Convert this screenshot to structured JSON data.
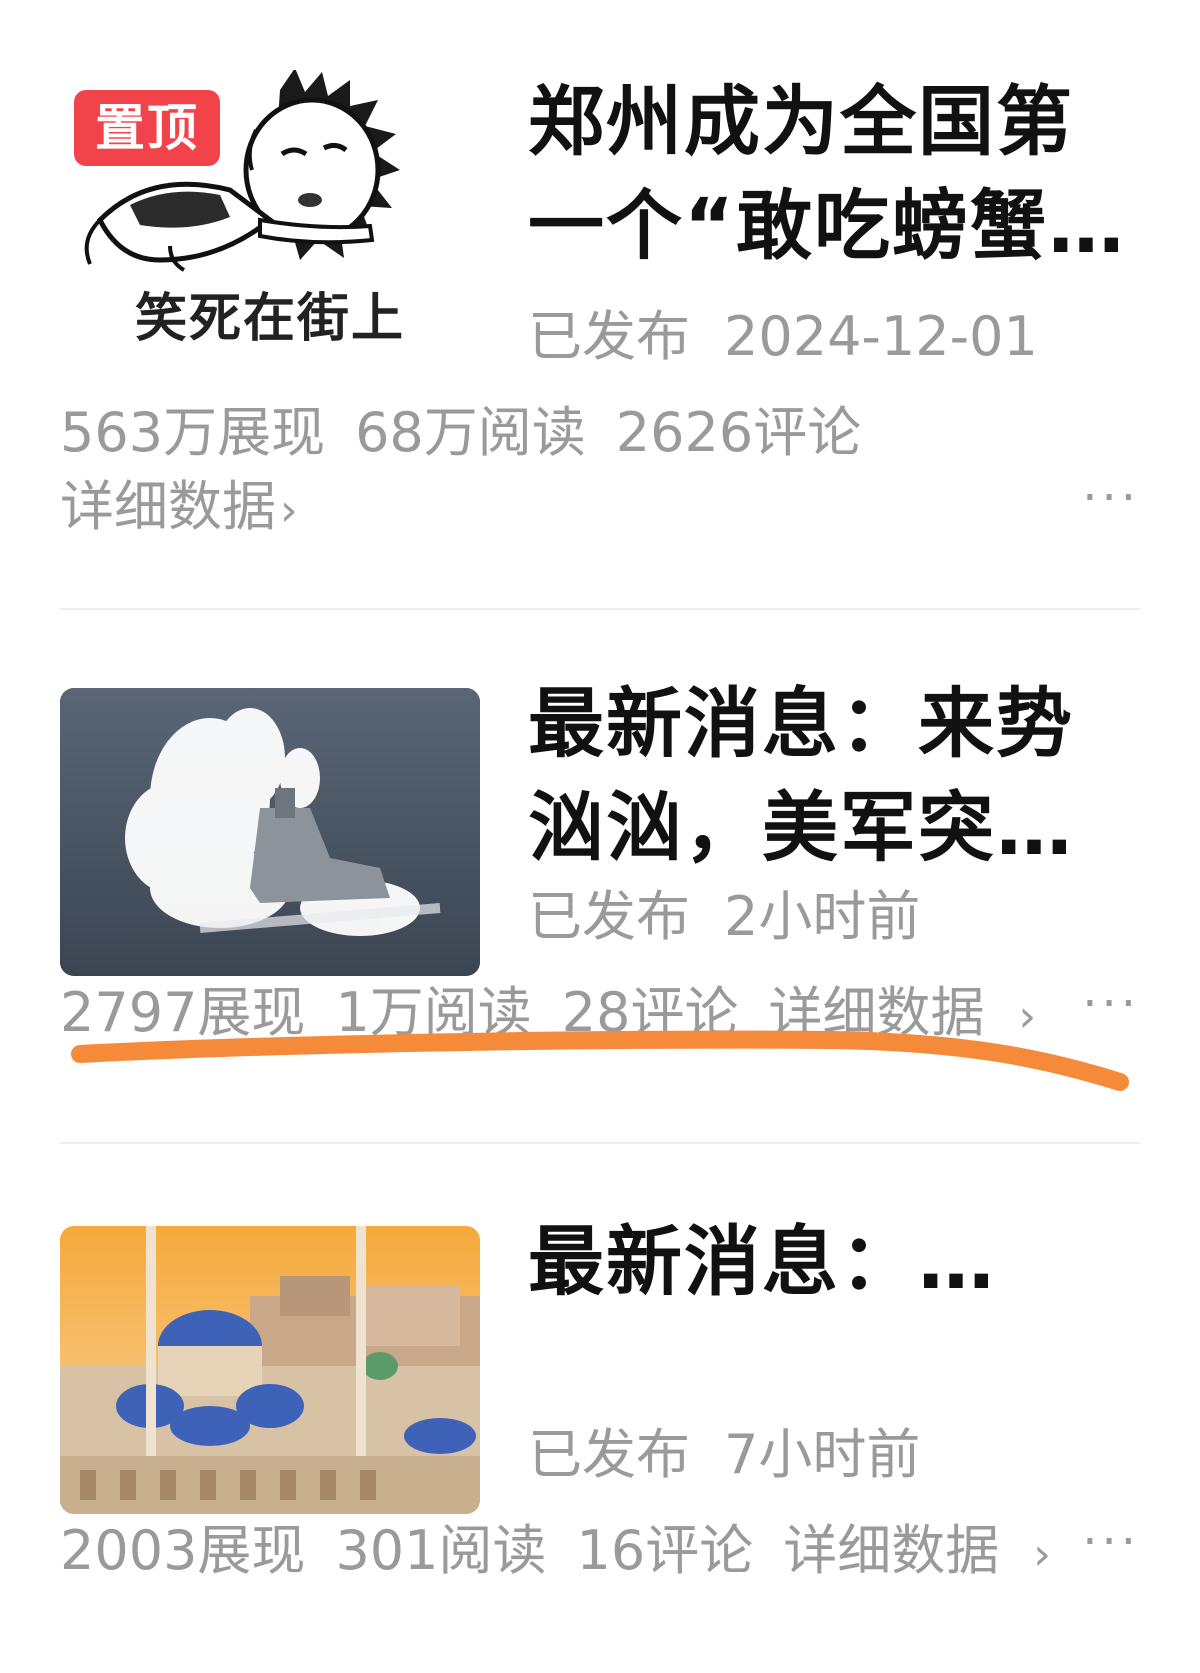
{
  "articles": [
    {
      "pin_label": "置顶",
      "thumb_caption": "笑死在街上",
      "title": "郑州成为全国第一个“敢吃螃蟹…",
      "status": "已发布",
      "time": "2024-12-01",
      "impressions": "563万展现",
      "reads": "68万阅读",
      "comments": "2626评论",
      "detail_label": "详细数据",
      "chevron": "›",
      "more_icon": "ellipsis-icon"
    },
    {
      "title": "最新消息：来势汹汹，美军突…",
      "status": "已发布",
      "time": "2小时前",
      "impressions": "2797展现",
      "reads": "1万阅读",
      "comments": "28评论",
      "detail_label": "详细数据",
      "chevron": "›",
      "more_icon": "ellipsis-icon"
    },
    {
      "title": "最新消息：…",
      "status": "已发布",
      "time": "7小时前",
      "impressions": "2003展现",
      "reads": "301阅读",
      "comments": "16评论",
      "detail_label": "详细数据",
      "chevron": "›",
      "more_icon": "ellipsis-icon"
    }
  ],
  "more_glyph": "···",
  "colors": {
    "title": "#111111",
    "meta": "#9a9a9a",
    "pin_badge": "#f2434a",
    "highlight_stroke": "#f58a3a",
    "divider": "#eeeeee"
  }
}
